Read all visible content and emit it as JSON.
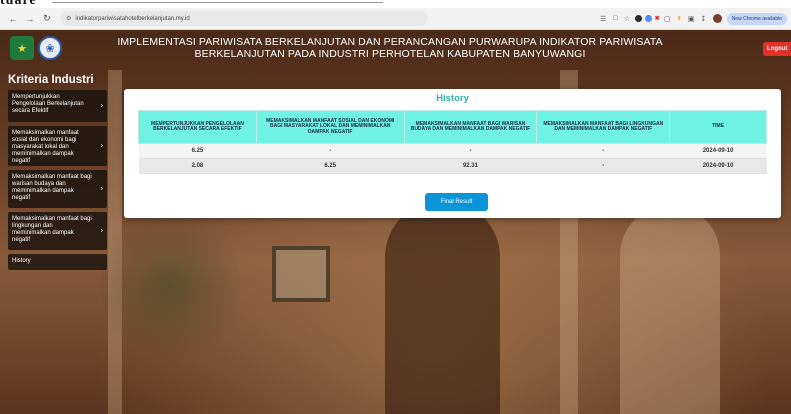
{
  "caption": {
    "text": "tuare"
  },
  "browser": {
    "url": "indikatorpariwisatahotelberkelanjutan.my.id",
    "update_label": "New Chrome available"
  },
  "header": {
    "title_line1": "IMPLEMENTASI PARIWISATA BERKELANJUTAN DAN PERANCANGAN PURWARUPA INDIKATOR PARIWISATA",
    "title_line2": "BERKELANJUTAN PADA INDUSTRI PERHOTELAN KABUPATEN BANYUWANGI",
    "logout_label": "Logout"
  },
  "sidebar": {
    "title": "Kriteria Industri",
    "items": [
      {
        "label": "Mempertunjukkan Pengelolaan Berkelanjutan secara Efektif"
      },
      {
        "label": "Memaksimalkan manfaat sosial dan ekonomi bagi masyarakat lokal dan meminimalkan dampak negatif"
      },
      {
        "label": "Memaksimalkan manfaat bagi warisan budaya dan meminimalkan dampak negatif"
      },
      {
        "label": "Memaksimalkan manfaat bagi lingkungan dan meminimalkan dampak negatif"
      },
      {
        "label": "History"
      }
    ]
  },
  "history": {
    "title": "History",
    "columns": [
      "MEMPERTUNJUKKAN PENGELOLAAN BERKELANJUTAN SECARA EFEKTIF",
      "MEMAKSIMALKAN MANFAAT SOSIAL DAN EKONOMI BAGI MASYARAKAT LOKAL DAN MEMINIMALKAN DAMPAK NEGATIF",
      "MEMAKSIMALKAN MANFAAT BAGI WARISAN BUDAYA DAN MEMINIMALKAN DAMPAK NEGATIF",
      "MEMAKSIMALKAN MANFAAT BAGI LINGKUNGAN DAN MEMINIMALKAN DAMPAK NEGATIF",
      "TIME"
    ],
    "rows": [
      [
        "6.25",
        "-",
        "-",
        "-",
        "2024-09-10"
      ],
      [
        "2.08",
        "6.25",
        "92.31",
        "-",
        "2024-09-10"
      ]
    ],
    "final_label": "Final Result"
  }
}
